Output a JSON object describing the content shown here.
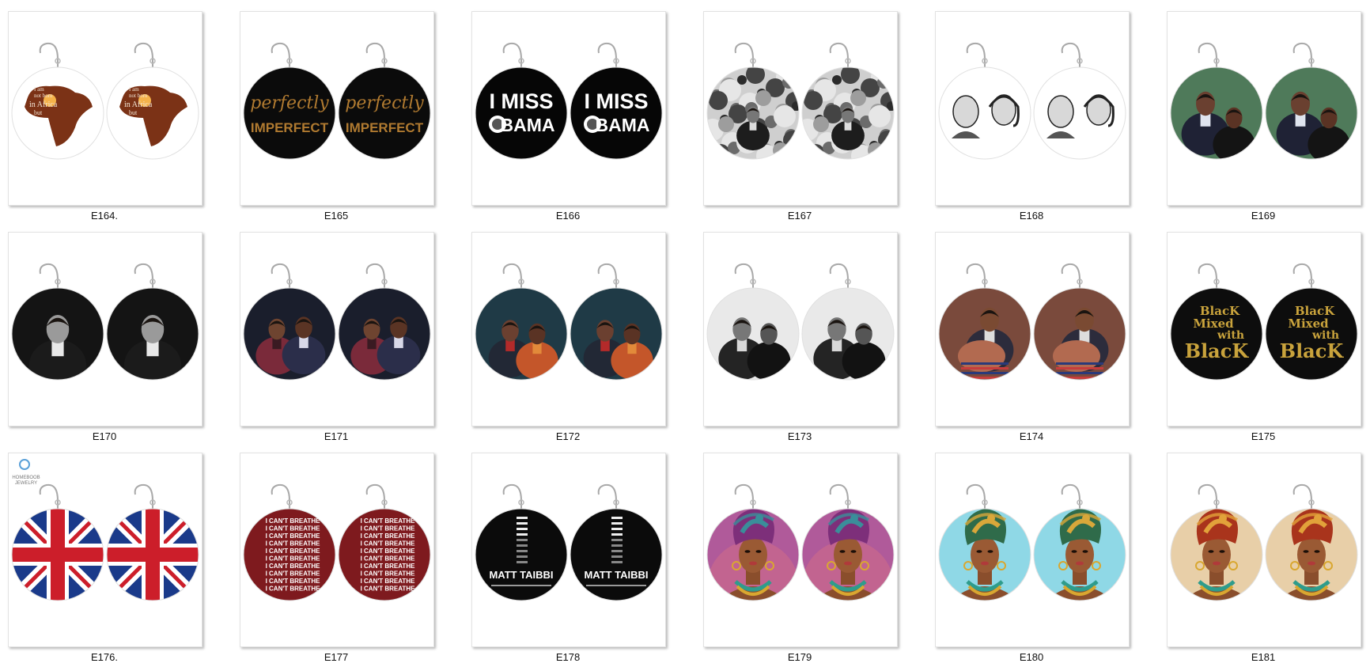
{
  "products": [
    {
      "code": "E164.",
      "design": "africa-map",
      "lines": [
        "I am",
        "not born",
        "in Africa",
        "but"
      ]
    },
    {
      "code": "E165",
      "design": "perfectly-imperfect",
      "lines": [
        "perfectly",
        "IMPERFECT"
      ]
    },
    {
      "code": "E166",
      "design": "i-miss-obama",
      "lines": [
        "I MISS",
        "BAMA"
      ]
    },
    {
      "code": "E167",
      "design": "bw-collage",
      "lines": []
    },
    {
      "code": "E168",
      "design": "couple-sketch",
      "lines": []
    },
    {
      "code": "E169",
      "design": "couple-photo-green",
      "lines": []
    },
    {
      "code": "E170",
      "design": "portrait-bw",
      "lines": []
    },
    {
      "code": "E171",
      "design": "couple-dark",
      "lines": []
    },
    {
      "code": "E172",
      "design": "couple-teal",
      "lines": []
    },
    {
      "code": "E173",
      "design": "couple-bw-grey",
      "lines": []
    },
    {
      "code": "E174",
      "design": "portrait-baby",
      "lines": []
    },
    {
      "code": "E175",
      "design": "black-mixed",
      "lines": [
        "BlacK",
        "Mixed",
        "with",
        "BlacK"
      ]
    },
    {
      "code": "E176.",
      "design": "union-jack",
      "lines": [],
      "brand": [
        "HOMEBOOB",
        "JEWELRY"
      ]
    },
    {
      "code": "E177",
      "design": "cant-breathe",
      "lines": [
        "I CAN'T BREATHE"
      ]
    },
    {
      "code": "E178",
      "design": "book-cover",
      "lines": [
        "MATT TAIBBI"
      ]
    },
    {
      "code": "E179",
      "design": "woman-pink",
      "lines": []
    },
    {
      "code": "E180",
      "design": "woman-cyan",
      "lines": []
    },
    {
      "code": "E181",
      "design": "woman-beige",
      "lines": []
    }
  ],
  "colors": {
    "card_border": "#e2e2e2",
    "page_bg": "#ffffff",
    "caption": "#111111",
    "hook": "#a9a9a9"
  }
}
